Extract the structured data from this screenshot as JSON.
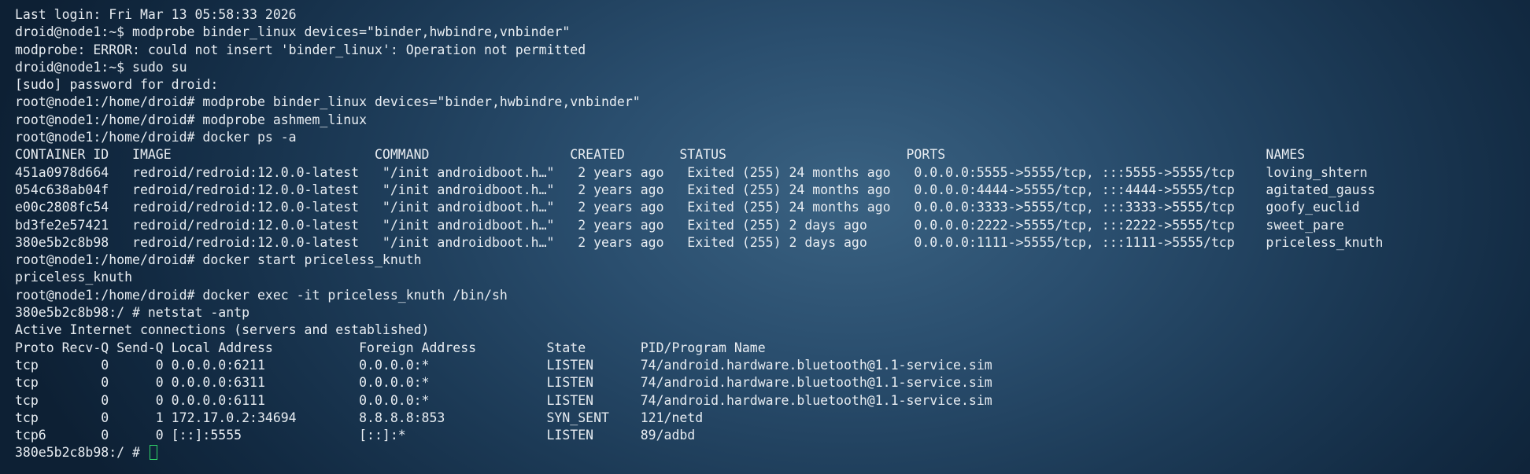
{
  "terminal": {
    "lines": [
      "Last login: Fri Mar 13 05:58:33 2026",
      "droid@node1:~$ modprobe binder_linux devices=\"binder,hwbindre,vnbinder\"",
      "modprobe: ERROR: could not insert 'binder_linux': Operation not permitted",
      "droid@node1:~$ sudo su",
      "[sudo] password for droid:",
      "root@node1:/home/droid# modprobe binder_linux devices=\"binder,hwbindre,vnbinder\"",
      "root@node1:/home/droid# modprobe ashmem_linux",
      "root@node1:/home/droid# docker ps -a",
      "CONTAINER ID   IMAGE                          COMMAND                  CREATED       STATUS                       PORTS                                         NAMES",
      "451a0978d664   redroid/redroid:12.0.0-latest   \"/init androidboot.h…\"   2 years ago   Exited (255) 24 months ago   0.0.0.0:5555->5555/tcp, :::5555->5555/tcp    loving_shtern",
      "054c638ab04f   redroid/redroid:12.0.0-latest   \"/init androidboot.h…\"   2 years ago   Exited (255) 24 months ago   0.0.0.0:4444->5555/tcp, :::4444->5555/tcp    agitated_gauss",
      "e00c2808fc54   redroid/redroid:12.0.0-latest   \"/init androidboot.h…\"   2 years ago   Exited (255) 24 months ago   0.0.0.0:3333->5555/tcp, :::3333->5555/tcp    goofy_euclid",
      "bd3fe2e57421   redroid/redroid:12.0.0-latest   \"/init androidboot.h…\"   2 years ago   Exited (255) 2 days ago      0.0.0.0:2222->5555/tcp, :::2222->5555/tcp    sweet_pare",
      "380e5b2c8b98   redroid/redroid:12.0.0-latest   \"/init androidboot.h…\"   2 years ago   Exited (255) 2 days ago      0.0.0.0:1111->5555/tcp, :::1111->5555/tcp    priceless_knuth",
      "root@node1:/home/droid# docker start priceless_knuth",
      "priceless_knuth",
      "root@node1:/home/droid# docker exec -it priceless_knuth /bin/sh",
      "380e5b2c8b98:/ # netstat -antp",
      "Active Internet connections (servers and established)",
      "Proto Recv-Q Send-Q Local Address           Foreign Address         State       PID/Program Name",
      "tcp        0      0 0.0.0.0:6211            0.0.0.0:*               LISTEN      74/android.hardware.bluetooth@1.1-service.sim",
      "tcp        0      0 0.0.0.0:6311            0.0.0.0:*               LISTEN      74/android.hardware.bluetooth@1.1-service.sim",
      "tcp        0      0 0.0.0.0:6111            0.0.0.0:*               LISTEN      74/android.hardware.bluetooth@1.1-service.sim",
      "tcp        0      1 172.17.0.2:34694        8.8.8.8:853             SYN_SENT    121/netd",
      "tcp6       0      0 [::]:5555               [::]:*                  LISTEN      89/adbd"
    ],
    "prompt": "380e5b2c8b98:/ # ",
    "cursor_color": "#31d46a"
  }
}
